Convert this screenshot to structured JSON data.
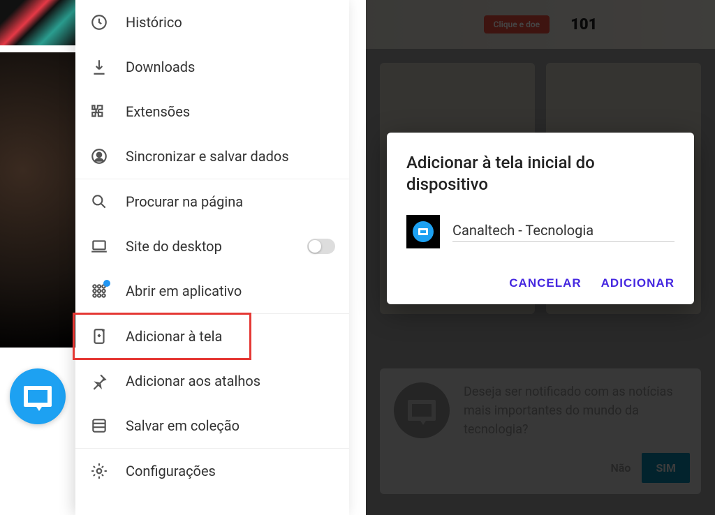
{
  "left_panel": {
    "menu": [
      {
        "key": "history",
        "label": "Histórico",
        "icon": "clock-icon",
        "sep": false,
        "toggle": false,
        "badge": false
      },
      {
        "key": "downloads",
        "label": "Downloads",
        "icon": "download-icon",
        "sep": false,
        "toggle": false,
        "badge": false
      },
      {
        "key": "extensions",
        "label": "Extensões",
        "icon": "puzzle-icon",
        "sep": false,
        "toggle": false,
        "badge": false
      },
      {
        "key": "sync",
        "label": "Sincronizar e salvar dados",
        "icon": "user-circle-icon",
        "sep": true,
        "toggle": false,
        "badge": false
      },
      {
        "key": "find",
        "label": "Procurar na página",
        "icon": "search-icon",
        "sep": false,
        "toggle": false,
        "badge": false
      },
      {
        "key": "desktop",
        "label": "Site do desktop",
        "icon": "laptop-icon",
        "sep": false,
        "toggle": true,
        "badge": false
      },
      {
        "key": "openapp",
        "label": "Abrir em aplicativo",
        "icon": "apps-icon",
        "sep": true,
        "toggle": false,
        "badge": true
      },
      {
        "key": "addhome",
        "label": "Adicionar à tela",
        "icon": "add-home-icon",
        "sep": false,
        "toggle": false,
        "badge": false,
        "highlight": true
      },
      {
        "key": "addshortcut",
        "label": "Adicionar aos atalhos",
        "icon": "pin-icon",
        "sep": false,
        "toggle": false,
        "badge": false
      },
      {
        "key": "savecoll",
        "label": "Salvar em coleção",
        "icon": "collection-icon",
        "sep": true,
        "toggle": false,
        "badge": false
      },
      {
        "key": "settings",
        "label": "Configurações",
        "icon": "gear-icon",
        "sep": false,
        "toggle": false,
        "badge": false
      }
    ],
    "highlight_index": 7
  },
  "right_panel": {
    "background": {
      "banner_pill": "Clique e doe",
      "banner_badge": "101",
      "notification_text": "Deseja ser notificado com as notícias mais importantes do mundo da tecnologia?",
      "btn_no": "Não",
      "btn_yes": "SIM"
    },
    "dialog": {
      "title": "Adicionar à tela inicial do dispositivo",
      "site_name": "Canaltech - Tecnologia",
      "cancel": "CANCELAR",
      "confirm": "ADICIONAR"
    }
  },
  "colors": {
    "highlight": "#e53935",
    "accent": "#4527e0",
    "brand": "#1da1f2"
  }
}
